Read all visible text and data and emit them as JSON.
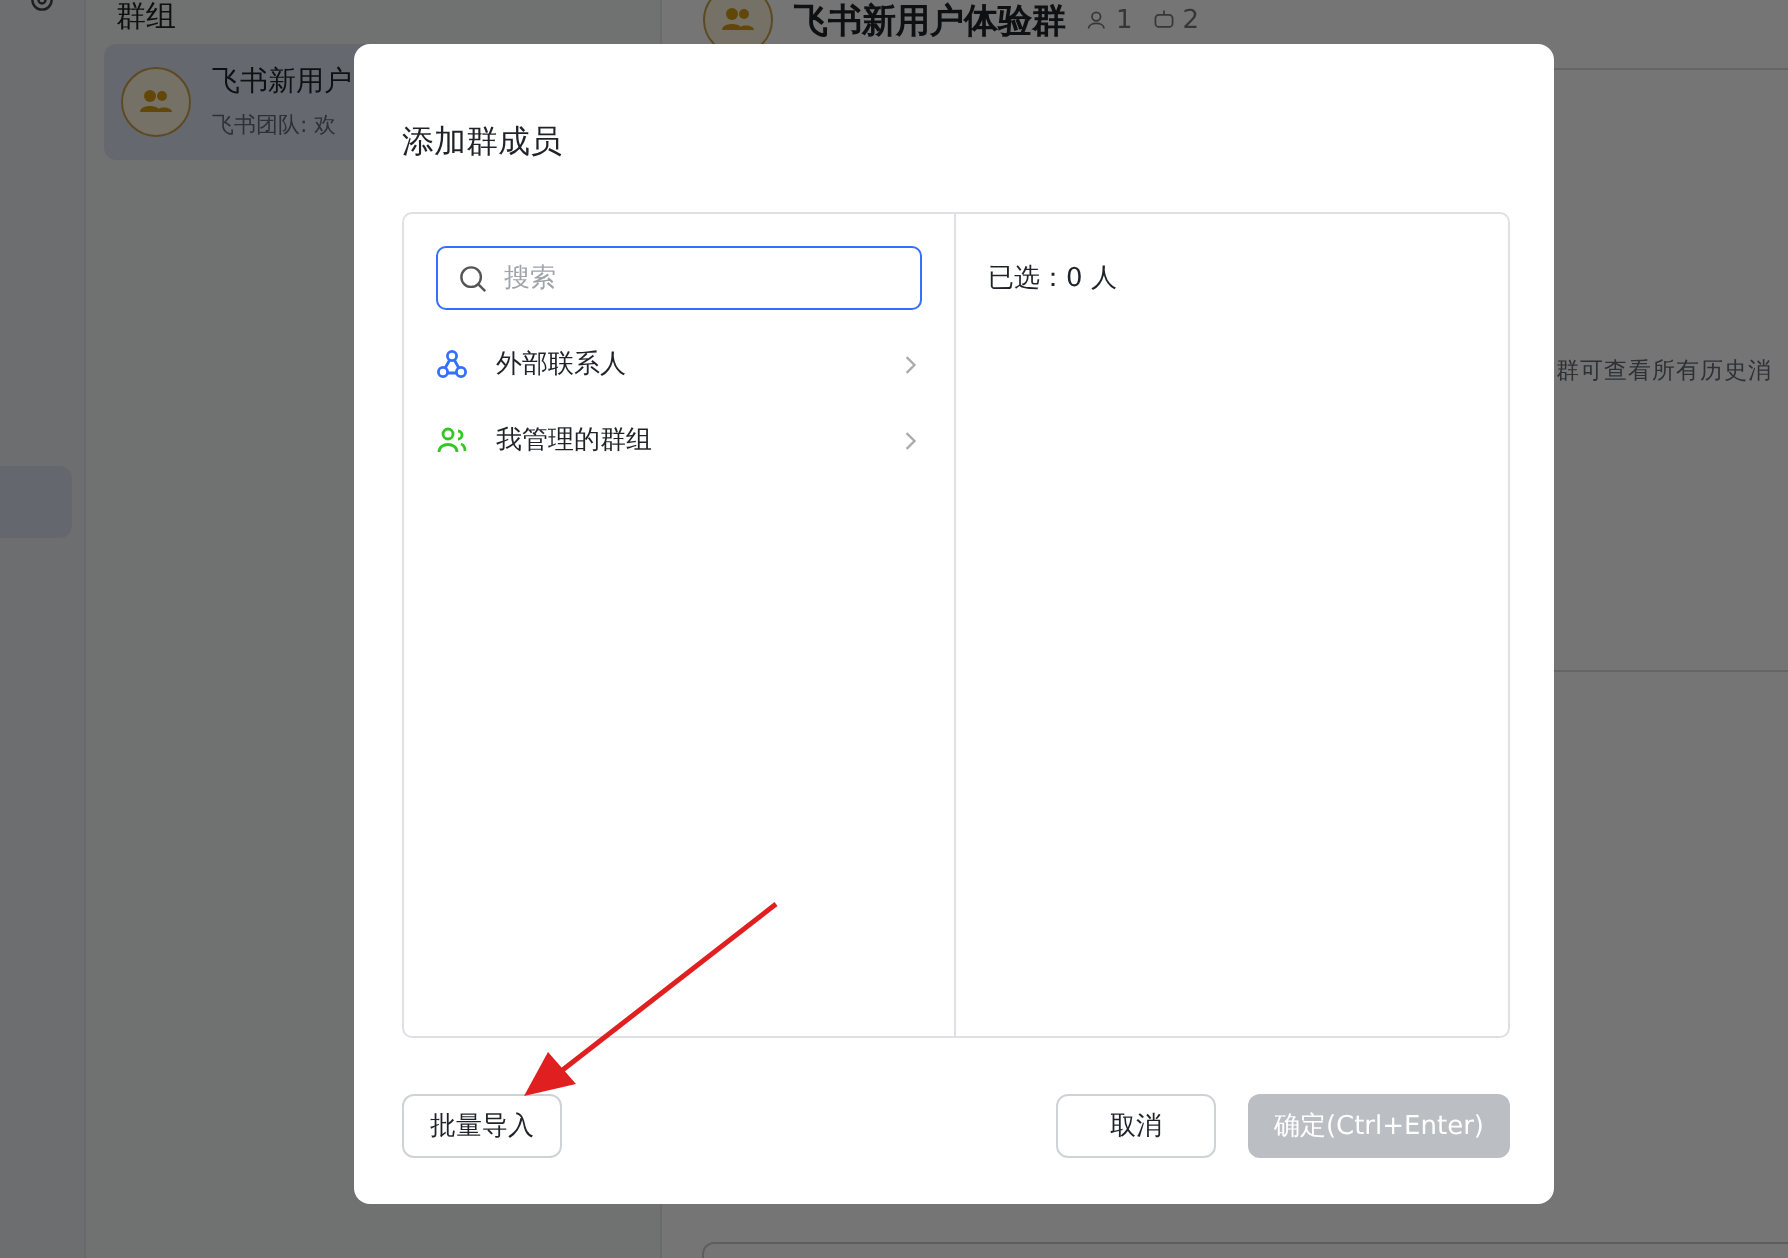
{
  "sidebar": {
    "items": [
      {
        "selected": true
      }
    ]
  },
  "chat_list": {
    "header": "群组",
    "chats": [
      {
        "name": "飞书新用户",
        "preview": "飞书团队: 欢",
        "selected": true
      }
    ]
  },
  "chat": {
    "title": "飞书新用户体验群",
    "member_count": "1",
    "bot_count": "2",
    "notice": "群可查看所有历史消"
  },
  "dialog": {
    "title": "添加群成员",
    "search": {
      "placeholder": "搜索"
    },
    "sources": [
      {
        "kind": "external",
        "label": "外部联系人"
      },
      {
        "kind": "groups",
        "label": "我管理的群组"
      }
    ],
    "selected_summary": "已选：0 人",
    "buttons": [
      {
        "kind": "secondary",
        "label": "批量导入",
        "disabled": false
      },
      {
        "kind": "secondary",
        "label": "取消",
        "disabled": false
      },
      {
        "kind": "primary",
        "label": "确定(Ctrl+Enter)",
        "disabled": true
      }
    ]
  },
  "annotation": {
    "kind": "arrow"
  }
}
